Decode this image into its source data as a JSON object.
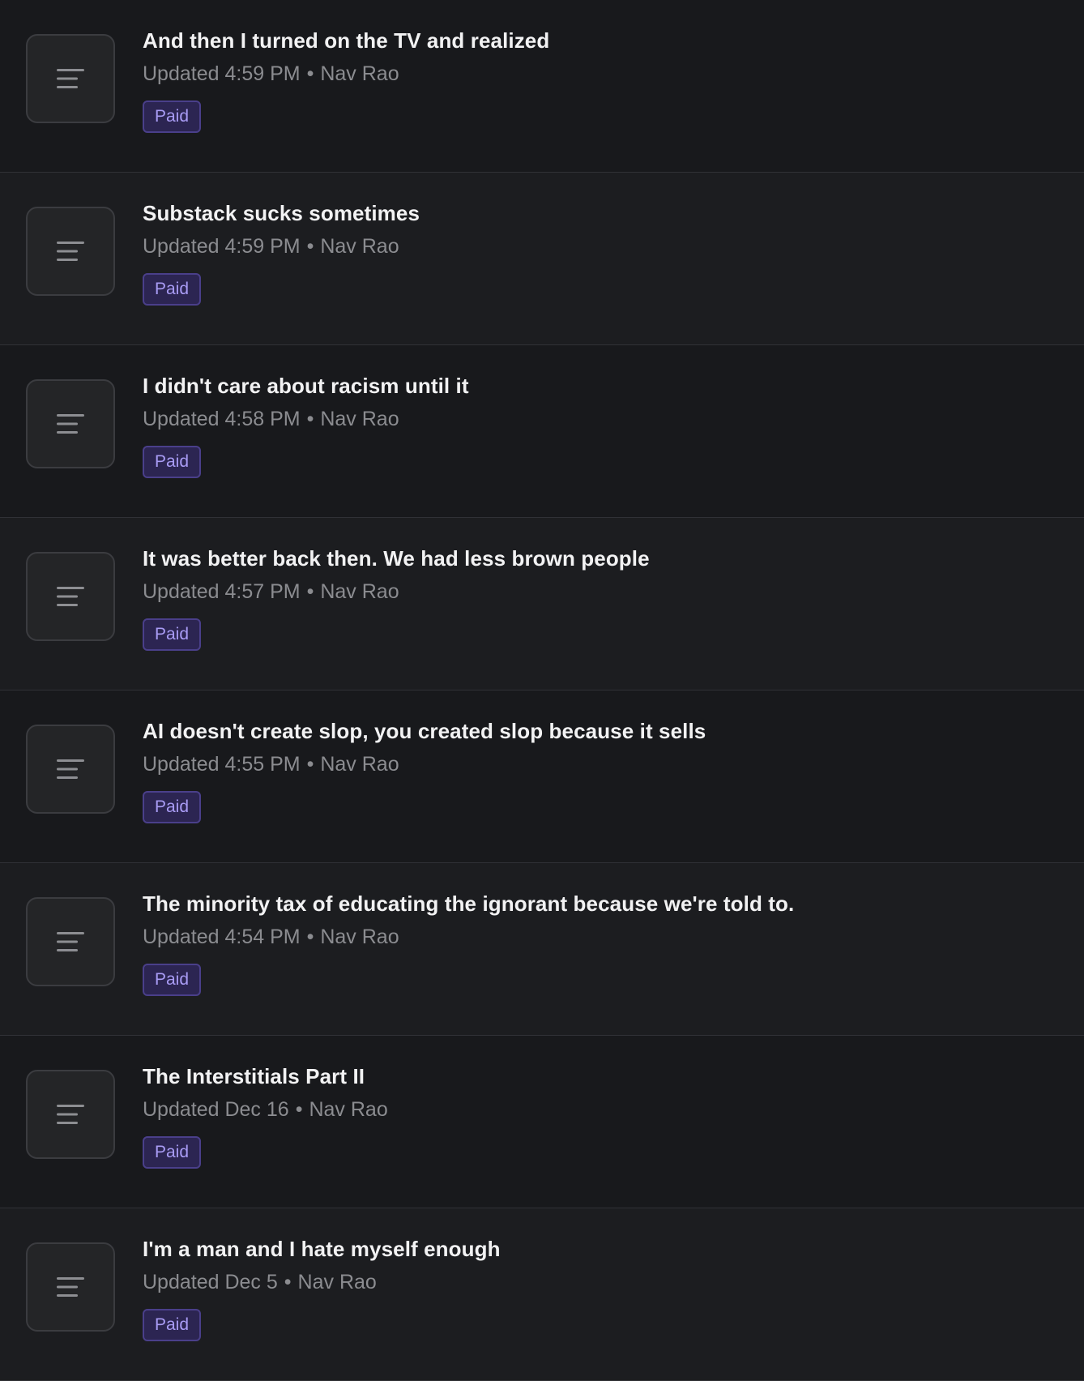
{
  "posts": [
    {
      "title": "And then I turned on the TV and realized",
      "updated": "Updated 4:59 PM",
      "author": "Nav Rao",
      "badge": "Paid",
      "icon": "document-lines-icon"
    },
    {
      "title": "Substack sucks sometimes",
      "updated": "Updated 4:59 PM",
      "author": "Nav Rao",
      "badge": "Paid",
      "icon": "document-lines-icon"
    },
    {
      "title": "I didn't care about racism until it",
      "updated": "Updated 4:58 PM",
      "author": "Nav Rao",
      "badge": "Paid",
      "icon": "document-lines-icon"
    },
    {
      "title": "It was better back then. We had less brown people",
      "updated": "Updated 4:57 PM",
      "author": "Nav Rao",
      "badge": "Paid",
      "icon": "document-lines-icon"
    },
    {
      "title": "AI doesn't create slop, you created slop because it sells",
      "updated": "Updated 4:55 PM",
      "author": "Nav Rao",
      "badge": "Paid",
      "icon": "document-lines-icon"
    },
    {
      "title": "The minority tax of educating the ignorant because we're told to.",
      "updated": "Updated 4:54 PM",
      "author": "Nav Rao",
      "badge": "Paid",
      "icon": "document-lines-icon"
    },
    {
      "title": "The Interstitials Part II",
      "updated": "Updated Dec 16",
      "author": "Nav Rao",
      "badge": "Paid",
      "icon": "document-lines-icon"
    },
    {
      "title": "I'm a man and I hate myself enough",
      "updated": "Updated Dec 5",
      "author": "Nav Rao",
      "badge": "Paid",
      "icon": "document-lines-icon"
    }
  ],
  "meta_separator": "•",
  "colors": {
    "background": "#18191c",
    "title": "#f2f2f3",
    "meta": "#8b8c90",
    "badge_text": "#a99cf5",
    "badge_bg": "#2c2552",
    "badge_border": "#4a3f8a"
  }
}
